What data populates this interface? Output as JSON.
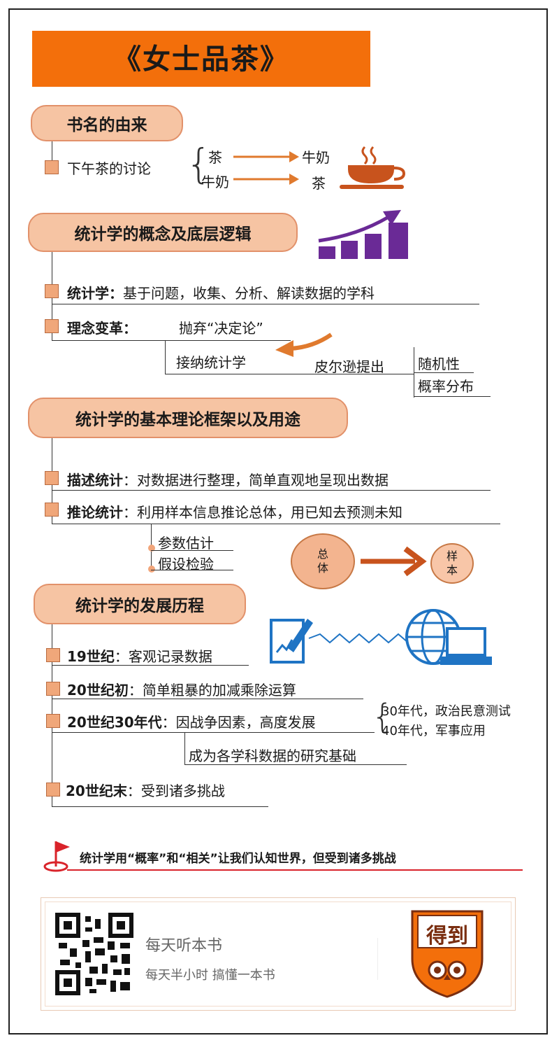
{
  "title": "《女士品茶》",
  "section1": {
    "heading": "书名的由来",
    "item": "下午茶的讨论",
    "row1_left": "茶",
    "row1_right": "牛奶",
    "row2_left": "牛奶",
    "row2_right": "茶"
  },
  "section2": {
    "heading": "统计学的概念及底层逻辑",
    "item1_bold": "统计学：",
    "item1_text": "基于问题，收集、分析、解读数据的学科",
    "item2_bold": "理念变革：",
    "item2_text": "抛弃“决定论”",
    "accept": "接纳统计学",
    "pierson": "皮尔逊提出",
    "sub1": "随机性",
    "sub2": "概率分布"
  },
  "section3": {
    "heading": "统计学的基本理论框架以及用途",
    "item1_bold": "描述统计",
    "item1_text": "：对数据进行整理，简单直观地呈现出数据",
    "item2_bold": "推论统计",
    "item2_text": "：利用样本信息推论总体，用已知去预测未知",
    "sub1": "参数估计",
    "sub2": "假设检验",
    "circle_left": "总\n体",
    "circle_right": "样\n本"
  },
  "section4": {
    "heading": "统计学的发展历程",
    "item1_bold": "19世纪",
    "item1_text": "：客观记录数据",
    "item2_bold": "20世纪初",
    "item2_text": "：简单粗暴的加减乘除运算",
    "item3_bold": "20世纪30年代",
    "item3_text": "：因战争因素，高度发展",
    "item3_sub1": "30年代，政治民意测试",
    "item3_sub2": "40年代，军事应用",
    "item3_result": "成为各学科数据的研究基础",
    "item4_bold": "20世纪末",
    "item4_text": "：受到诸多挑战"
  },
  "conclusion": "统计学用“概率”和“相关”让我们认知世界，但受到诸多挑战",
  "footer": {
    "line1": "每天听本书",
    "line2": "每天半小时  搞懂一本书",
    "logo_text": "得到"
  },
  "colors": {
    "banner": "#f36f0b",
    "pill_fill": "#f6c4a3",
    "pill_border": "#e2916a",
    "accent_arrow": "#e07a2e",
    "chart_purple": "#6a2a96",
    "icon_blue": "#1f74c4",
    "red_line": "#d9232a"
  },
  "icons": [
    "coffee-cup-icon",
    "growth-chart-icon",
    "document-pen-icon",
    "globe-laptop-icon",
    "red-flag-icon",
    "qr-code-icon",
    "dedao-owl-logo"
  ]
}
